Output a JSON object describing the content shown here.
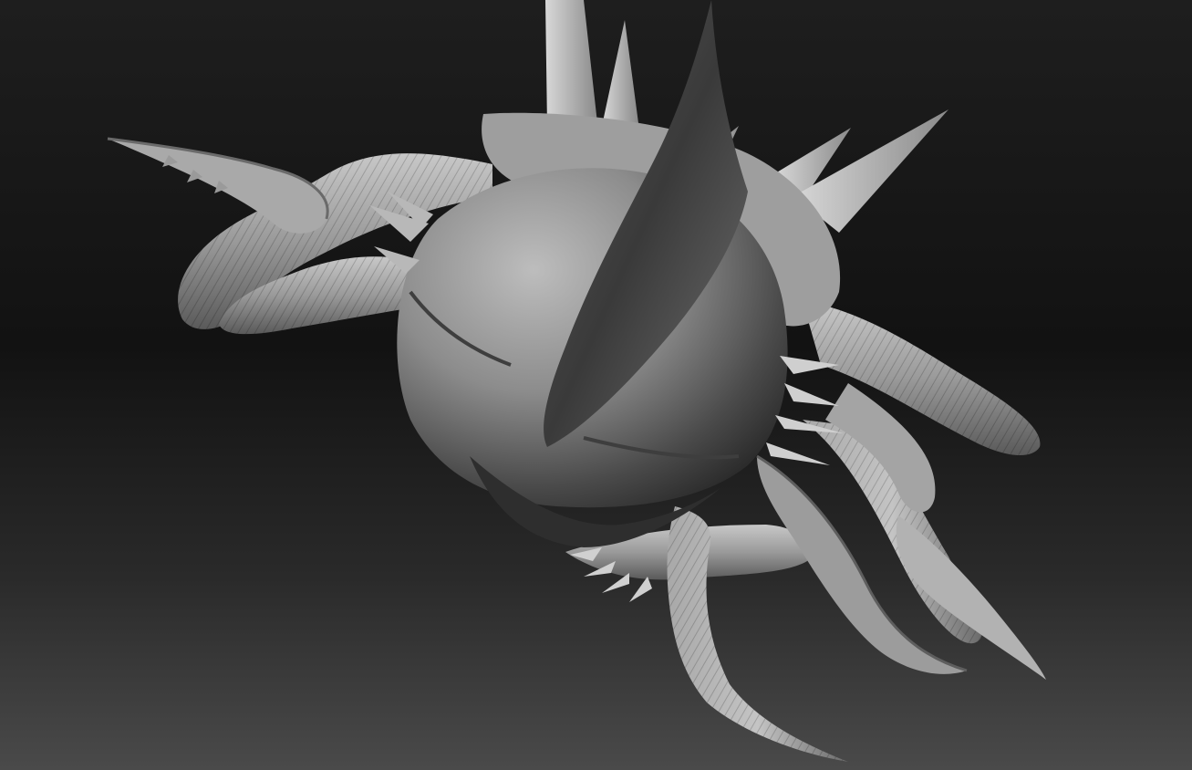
{
  "viewport": {
    "subject": "creature-sculpt",
    "background_top": "#1e1e1e",
    "background_bottom": "#4a4a4a",
    "material_light": "#b4b4b4",
    "material_mid": "#8a8a8a",
    "material_dark": "#3a3a3a"
  }
}
